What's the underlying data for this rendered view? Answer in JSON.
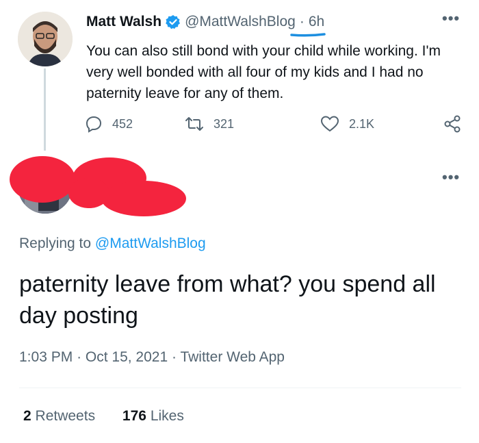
{
  "parent_tweet": {
    "author_name": "Matt Walsh",
    "handle": "@MattWalshBlog",
    "separator": "·",
    "time_ago": "6h",
    "text": "You can also still bond with your child while working. I'm very well bonded with all four of my kids and I had no paternity leave for any of them.",
    "actions": {
      "replies": "452",
      "retweets": "321",
      "likes": "2.1K"
    },
    "icons": [
      "reply-icon",
      "retweet-icon",
      "like-icon",
      "share-icon",
      "verified-badge-icon",
      "more-options-icon"
    ]
  },
  "reply_tweet": {
    "replying_prefix": "Replying to",
    "replying_handle": "@MattWalshBlog",
    "text": "paternity leave from what? you spend all day posting",
    "time": "1:03 PM",
    "date": "Oct 15, 2021",
    "source": "Twitter Web App",
    "meta_separator": "·",
    "stats": {
      "retweets_count": "2",
      "retweets_label": "Retweets",
      "likes_count": "176",
      "likes_label": "Likes"
    }
  },
  "colors": {
    "link_blue": "#1d9bf0",
    "secondary_gray": "#536471",
    "redaction_red": "#f4243e",
    "verified_blue": "#1d9bf0"
  }
}
